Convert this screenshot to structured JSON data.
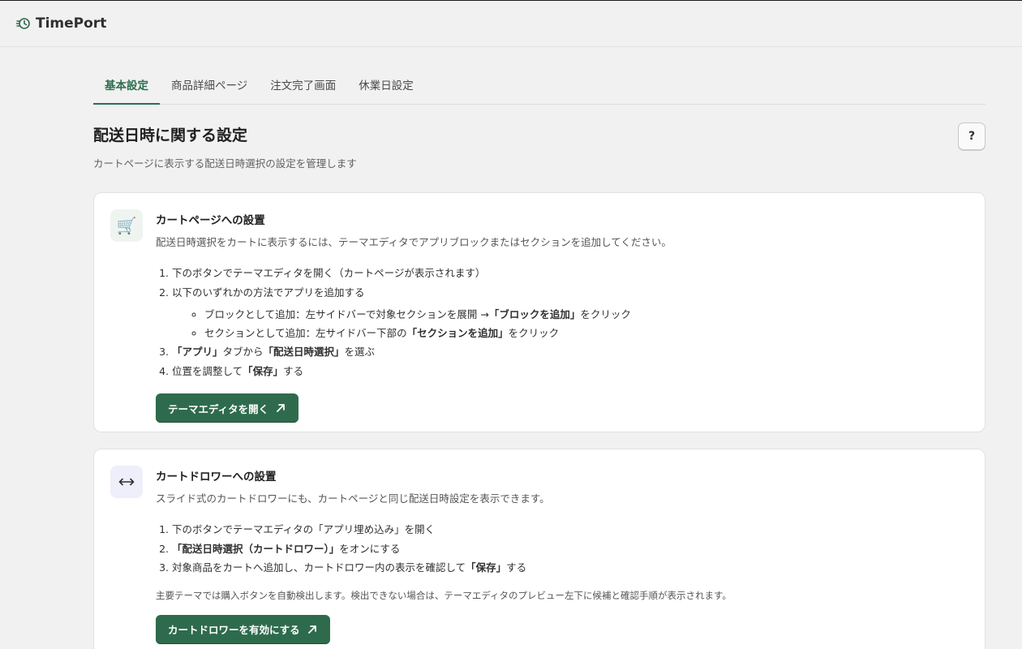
{
  "app": {
    "name": "TimePort",
    "logo_icon": "clock-history-icon",
    "accent_color": "#2e6b4c"
  },
  "tabs": [
    {
      "label": "基本設定",
      "active": true
    },
    {
      "label": "商品詳細ページ",
      "active": false
    },
    {
      "label": "注文完了画面",
      "active": false
    },
    {
      "label": "休業日設定",
      "active": false
    }
  ],
  "page": {
    "title": "配送日時に関する設定",
    "subtitle": "カートページに表示する配送日時選択の設定を管理します",
    "help_label": "?"
  },
  "cart_page_card": {
    "icon": "shopping-cart-icon",
    "title": "カートページへの設置",
    "description": "配送日時選択をカートに表示するには、テーマエディタでアプリブロックまたはセクションを追加してください。",
    "steps": [
      {
        "text": "下のボタンでテーマエディタを開く（カートページが表示されます）"
      },
      {
        "text": "以下のいずれかの方法でアプリを追加する"
      },
      {
        "pre": "",
        "bold": "「アプリ」",
        "mid": "タブから",
        "bold2": "「配送日時選択」",
        "post": "を選ぶ"
      },
      {
        "pre": "位置を調整して",
        "bold": "「保存」",
        "post": "する"
      }
    ],
    "sub_steps": [
      {
        "pre": "ブロックとして追加：左サイドバーで対象セクションを展開 →",
        "bold": "「ブロックを追加」",
        "post": "をクリック"
      },
      {
        "pre": "セクションとして追加：左サイドバー下部の",
        "bold": "「セクションを追加」",
        "post": "をクリック"
      }
    ],
    "button_label": "テーマエディタを開く"
  },
  "cart_drawer_card": {
    "icon": "left-right-arrow-icon",
    "title": "カートドロワーへの設置",
    "description": "スライド式のカートドロワーにも、カートページと同じ配送日時設定を表示できます。",
    "steps": [
      {
        "text": "下のボタンでテーマエディタの「アプリ埋め込み」を開く"
      },
      {
        "bold": "「配送日時選択（カートドロワー）」",
        "post": "をオンにする"
      },
      {
        "pre": "対象商品をカートへ追加し、カートドロワー内の表示を確認して",
        "bold": "「保存」",
        "post": "する"
      }
    ],
    "note": "主要テーマでは購入ボタンを自動検出します。検出できない場合は、テーマエディタのプレビュー左下に候補と確認手順が表示されます。",
    "button_label": "カートドロワーを有効にする"
  }
}
